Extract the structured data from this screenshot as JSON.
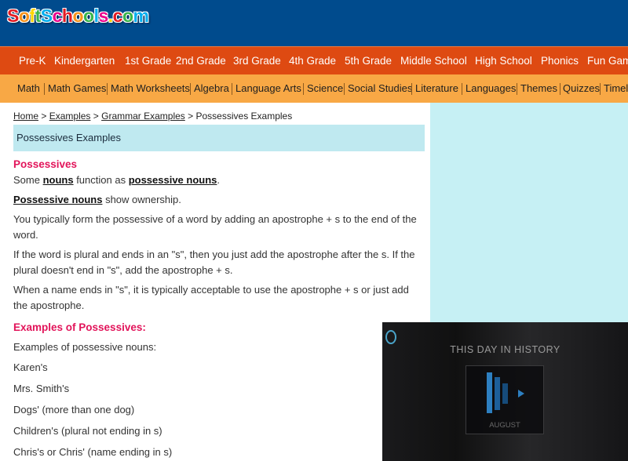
{
  "header": {
    "logo_parts": [
      "S",
      "o",
      "f",
      "t",
      "S",
      "c",
      "h",
      "o",
      "o",
      "l",
      "s",
      ".",
      "c",
      "o",
      "m"
    ],
    "logo_colors": [
      "#e31b23",
      "#f7941d",
      "#ffd400",
      "#39b54a",
      "#00aeef",
      "#ec008c",
      "#e31b23",
      "#f7941d",
      "#39b54a",
      "#00aeef",
      "#ec008c",
      "#ffd400",
      "#e31b23",
      "#39b54a",
      "#00aeef"
    ]
  },
  "grade_nav": [
    "Pre-K",
    "Kindergarten",
    "1st Grade",
    "2nd Grade",
    "3rd Grade",
    "4th Grade",
    "5th Grade",
    "Middle School",
    "High School",
    "Phonics",
    "Fun Gam"
  ],
  "subject_nav": [
    "Math",
    "Math Games",
    "Math Worksheets",
    "Algebra",
    "Language Arts",
    "Science",
    "Social Studies",
    "Literature",
    "Languages",
    "Themes",
    "Quizzes",
    "Timel"
  ],
  "breadcrumb": {
    "home": "Home",
    "examples": "Examples",
    "grammar": "Grammar Examples",
    "current": "Possessives Examples",
    "sep": ">"
  },
  "page_title": "Possessives Examples",
  "content": {
    "heading1": "Possessives",
    "p1_a": "Some ",
    "p1_link1": "nouns",
    "p1_b": " function as ",
    "p1_link2": "possessive nouns",
    "p1_c": ".",
    "p2_link": "Possessive nouns",
    "p2_b": " show ownership.",
    "p3": "You typically form the possessive of a word by adding an apostrophe + s to the end of the word.",
    "p4": "If the word is plural and ends in an \"s\", then you just add the apostrophe after the s. If the plural doesn't end in \"s\", add the apostrophe + s.",
    "p5": "When a name ends in \"s\", it is typically acceptable to use the apostrophe + s or just add the apostrophe.",
    "heading2": "Examples of Possessives:",
    "examples_intro": "Examples of possessive nouns:",
    "examples": [
      "Karen's",
      "Mrs. Smith's",
      "Dogs' (more than one dog)",
      "Children's (plural not ending in s)",
      "Chris's or Chris' (name ending in s)"
    ]
  },
  "video": {
    "title": "THIS DAY IN HISTORY",
    "month": "AUGUST"
  }
}
